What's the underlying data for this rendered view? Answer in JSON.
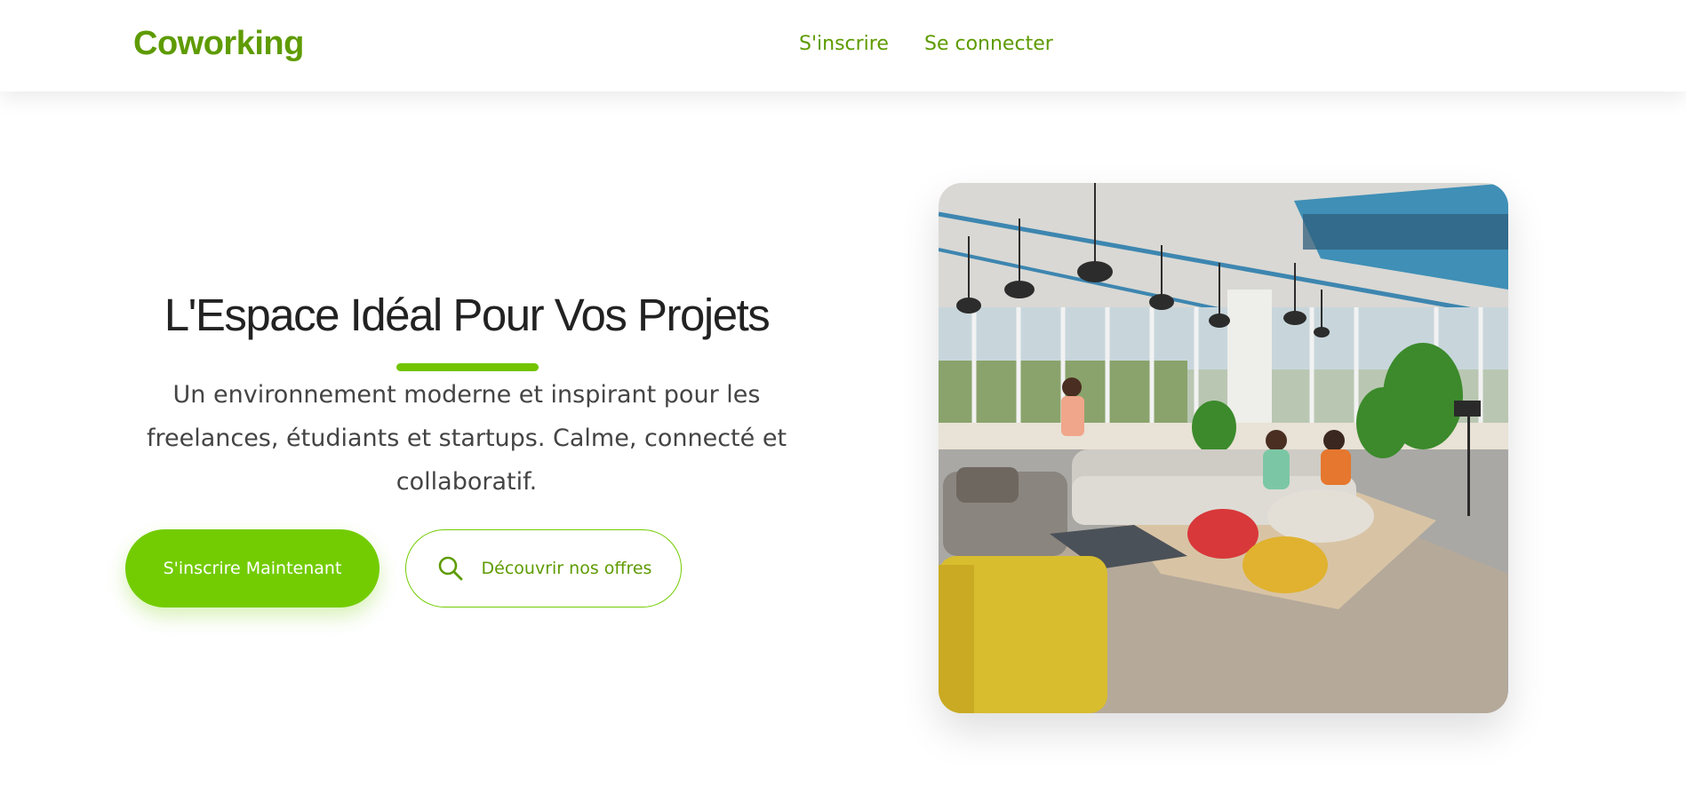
{
  "brand": {
    "name": "Coworking",
    "accent": "#73cc02",
    "accent_dark": "#5e9b00"
  },
  "nav": {
    "signup": "S'inscrire",
    "login": "Se connecter"
  },
  "hero": {
    "title": "L'Espace Idéal Pour Vos Projets",
    "subtitle": "Un environnement moderne et inspirant pour les freelances, étudiants et startups. Calme, connecté et collaboratif.",
    "primary_button": "S'inscrire Maintenant",
    "secondary_button": "Découvrir nos offres",
    "secondary_icon": "search-icon"
  }
}
